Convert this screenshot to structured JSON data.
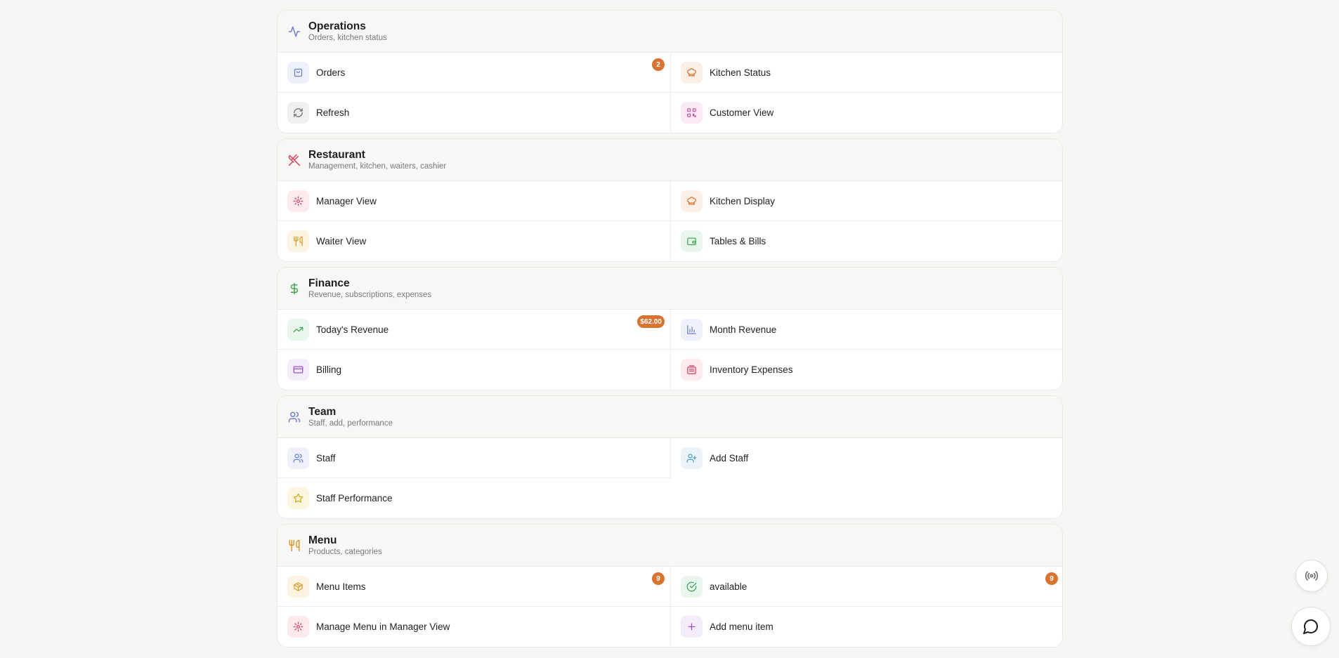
{
  "sections": {
    "operations": {
      "title": "Operations",
      "subtitle": "Orders, kitchen status",
      "icon": "activity-icon",
      "items": {
        "orders": {
          "label": "Orders",
          "badge": "2",
          "icon": "shopping-bag-icon"
        },
        "kitchen_status": {
          "label": "Kitchen Status",
          "icon": "chef-hat-icon"
        },
        "refresh": {
          "label": "Refresh",
          "icon": "refresh-icon"
        },
        "customer_view": {
          "label": "Customer View",
          "icon": "qr-code-icon"
        }
      }
    },
    "restaurant": {
      "title": "Restaurant",
      "subtitle": "Management, kitchen, waiters, cashier",
      "icon": "utensils-crossed-icon",
      "items": {
        "manager_view": {
          "label": "Manager View",
          "icon": "gear-icon"
        },
        "kitchen_display": {
          "label": "Kitchen Display",
          "icon": "chef-hat-icon"
        },
        "waiter_view": {
          "label": "Waiter View",
          "icon": "utensils-icon"
        },
        "tables_bills": {
          "label": "Tables & Bills",
          "icon": "wallet-icon"
        }
      }
    },
    "finance": {
      "title": "Finance",
      "subtitle": "Revenue, subscriptions, expenses",
      "icon": "dollar-icon",
      "items": {
        "todays_revenue": {
          "label": "Today's Revenue",
          "badge": "$62.00",
          "icon": "trending-up-icon"
        },
        "month_revenue": {
          "label": "Month Revenue",
          "icon": "bar-chart-icon"
        },
        "billing": {
          "label": "Billing",
          "icon": "credit-card-icon"
        },
        "inventory_expenses": {
          "label": "Inventory Expenses",
          "icon": "receipt-icon"
        }
      }
    },
    "team": {
      "title": "Team",
      "subtitle": "Staff, add, performance",
      "icon": "users-icon",
      "items": {
        "staff": {
          "label": "Staff",
          "icon": "users-icon"
        },
        "add_staff": {
          "label": "Add Staff",
          "icon": "user-plus-icon"
        },
        "staff_performance": {
          "label": "Staff Performance",
          "icon": "star-icon"
        }
      }
    },
    "menu": {
      "title": "Menu",
      "subtitle": "Products, categories",
      "icon": "utensils-icon",
      "items": {
        "menu_items": {
          "label": "Menu Items",
          "badge": "9",
          "icon": "package-icon"
        },
        "available": {
          "label": "available",
          "badge": "9",
          "icon": "check-circle-icon"
        },
        "manage_menu": {
          "label": "Manage Menu in Manager View",
          "icon": "gear-icon"
        },
        "add_menu_item": {
          "label": "Add menu item",
          "icon": "plus-icon"
        }
      }
    }
  },
  "fabs": {
    "broadcast": {
      "icon": "radio-broadcast-icon"
    },
    "chat": {
      "icon": "chat-bubble-icon"
    }
  },
  "colors": {
    "badge": "#d97330",
    "page_bg": "#f7f6f4"
  }
}
